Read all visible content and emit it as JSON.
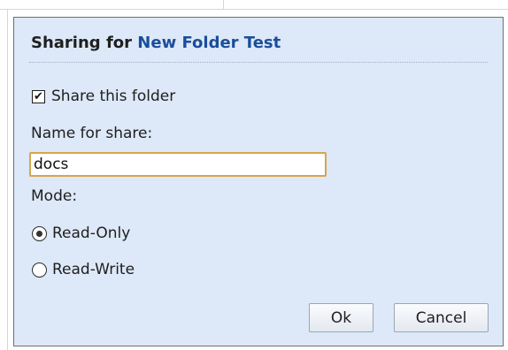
{
  "dialog": {
    "title_prefix": "Sharing for",
    "folder_name": "New Folder Test",
    "share_checkbox": {
      "label": "Share this folder",
      "checked": true
    },
    "share_name": {
      "label": "Name for share:",
      "value": "docs"
    },
    "mode": {
      "label": "Mode:",
      "options": [
        {
          "label": "Read-Only",
          "selected": true
        },
        {
          "label": "Read-Write",
          "selected": false
        }
      ]
    },
    "buttons": {
      "ok": "Ok",
      "cancel": "Cancel"
    },
    "colors": {
      "background": "#dde8f8",
      "folder_name": "#1a4e9b",
      "input_focus_border": "#d8a54b",
      "border": "#6f6f6f"
    }
  },
  "icons": {
    "checkbox_mark": "check-icon",
    "radio_selected": "radio-dot-icon"
  }
}
